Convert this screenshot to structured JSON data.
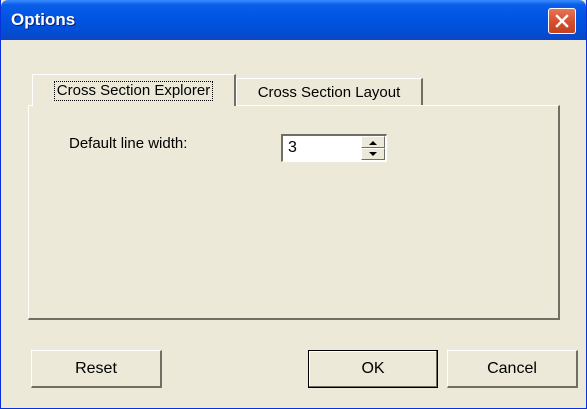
{
  "window": {
    "title": "Options",
    "close_icon": "close-icon"
  },
  "tabs": [
    {
      "label": "Cross Section Explorer",
      "selected": true
    },
    {
      "label": "Cross Section Layout",
      "selected": false
    }
  ],
  "settings": {
    "line_width_label": "Default line width:",
    "line_width_value": "3"
  },
  "buttons": {
    "reset": "Reset",
    "ok": "OK",
    "cancel": "Cancel"
  },
  "colors": {
    "title_bar": "#0054e3",
    "dialog_face": "#ece9d8",
    "close_button": "#d7502f"
  }
}
